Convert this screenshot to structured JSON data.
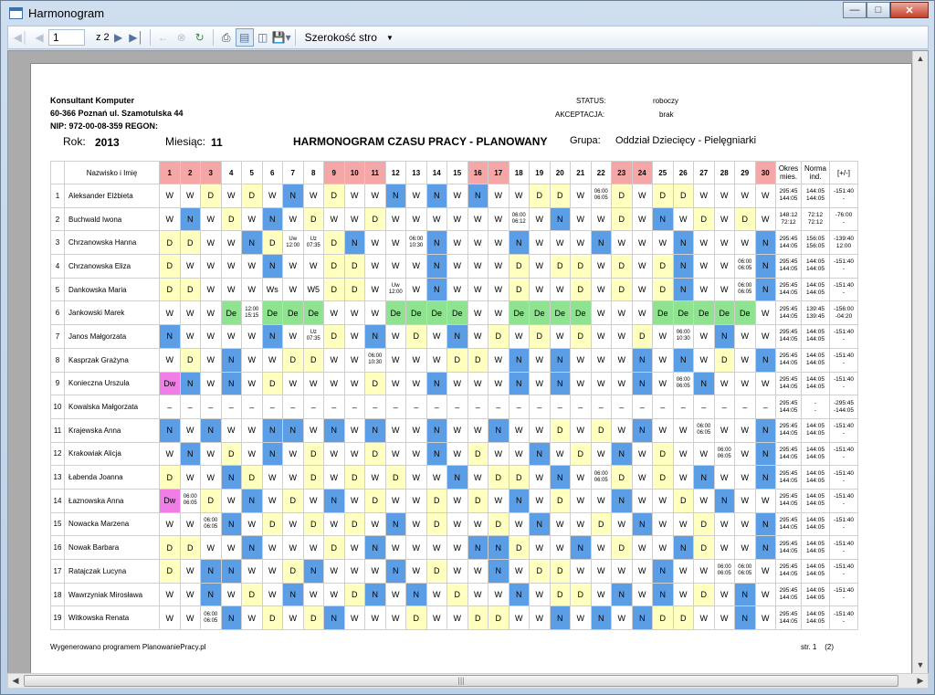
{
  "window": {
    "title": "Harmonogram"
  },
  "toolbar": {
    "page": "1",
    "of_label": "z",
    "total_pages": "2",
    "width_mode": "Szerokość stro"
  },
  "company": {
    "name": "Konsultant Komputer",
    "address": "60-366 Poznań ul. Szamotulska 44",
    "ids": "NIP: 972-00-08-359 REGON:"
  },
  "status": {
    "status_label": "STATUS:",
    "status_value": "roboczy",
    "accept_label": "AKCEPTACJA:",
    "accept_value": "brak"
  },
  "header": {
    "year_label": "Rok:",
    "year": "2013",
    "month_label": "Miesiąc:",
    "month": "11",
    "title": "HARMONOGRAM CZASU PRACY - PLANOWANY",
    "group_label": "Grupa:",
    "group": "Oddział Dziecięcy - Pielęgniarki"
  },
  "table": {
    "name_header": "Nazwisko i Imię",
    "days": [
      "1",
      "2",
      "3",
      "4",
      "5",
      "6",
      "7",
      "8",
      "9",
      "10",
      "11",
      "12",
      "13",
      "14",
      "15",
      "16",
      "17",
      "18",
      "19",
      "20",
      "21",
      "22",
      "23",
      "24",
      "25",
      "26",
      "27",
      "28",
      "29",
      "30"
    ],
    "red_days": [
      "1",
      "2",
      "3",
      "9",
      "10",
      "11",
      "16",
      "17",
      "23",
      "24",
      "30"
    ],
    "sum_headers": [
      "Okres mies.",
      "Norma ind.",
      "[+/-]"
    ],
    "rows": [
      {
        "lp": "1",
        "name": "Aleksander Elżbieta",
        "cells": [
          "W",
          "W",
          "D",
          "W",
          "D",
          "W",
          "N",
          "W",
          "D",
          "W",
          "W",
          "N",
          "W",
          "N",
          "W",
          "N",
          "W",
          "W",
          "D",
          "D",
          "W",
          "06:00 06:05",
          "D",
          "W",
          "D",
          "D",
          "W",
          "W",
          "W",
          "W"
        ],
        "okres": "295:45 144:05",
        "norma": "144:05 144:05",
        "diff": "-151:40 -"
      },
      {
        "lp": "2",
        "name": "Buchwald Iwona",
        "cells": [
          "W",
          "N",
          "W",
          "D",
          "W",
          "N",
          "W",
          "D",
          "W",
          "W",
          "D",
          "W",
          "W",
          "W",
          "W",
          "W",
          "W",
          "06:00 06:12",
          "W",
          "N",
          "W",
          "W",
          "D",
          "W",
          "N",
          "W",
          "D",
          "W",
          "D",
          "W"
        ],
        "okres": "148:12 72:12",
        "norma": "72:12 72:12",
        "diff": "-76:00 -"
      },
      {
        "lp": "3",
        "name": "Chrzanowska Hanna",
        "cells": [
          "D",
          "D",
          "W",
          "W",
          "N",
          "D",
          "Uw 12:00",
          "Uz 07:35",
          "D",
          "N",
          "W",
          "W",
          "06:00 10:30",
          "N",
          "W",
          "W",
          "W",
          "N",
          "W",
          "W",
          "W",
          "N",
          "W",
          "W",
          "W",
          "N",
          "W",
          "W",
          "W",
          "N"
        ],
        "okres": "295:45 144:05",
        "norma": "156:05 156:05",
        "diff": "-139:40 12:00"
      },
      {
        "lp": "4",
        "name": "Chrzanowska Eliza",
        "cells": [
          "D",
          "W",
          "W",
          "W",
          "W",
          "N",
          "W",
          "W",
          "D",
          "D",
          "W",
          "W",
          "W",
          "N",
          "W",
          "W",
          "W",
          "D",
          "W",
          "D",
          "D",
          "W",
          "D",
          "W",
          "D",
          "N",
          "W",
          "W",
          "06:00 06:05",
          "N"
        ],
        "okres": "295:45 144:05",
        "norma": "144:05 144:05",
        "diff": "-151:40 -"
      },
      {
        "lp": "5",
        "name": "Dankowska Maria",
        "cells": [
          "D",
          "D",
          "W",
          "W",
          "W",
          "Ws",
          "W",
          "W5",
          "D",
          "D",
          "W",
          "Uw 12:00",
          "W",
          "N",
          "W",
          "W",
          "W",
          "D",
          "W",
          "W",
          "D",
          "W",
          "D",
          "W",
          "D",
          "N",
          "W",
          "W",
          "06:00 06:05",
          "N"
        ],
        "okres": "295:45 144:05",
        "norma": "144:05 144:05",
        "diff": "-151:40 -"
      },
      {
        "lp": "6",
        "name": "Jankowski Marek",
        "cells": [
          "W",
          "W",
          "W",
          "De",
          "12:00 15:15",
          "De",
          "De",
          "De",
          "W",
          "W",
          "W",
          "De",
          "De",
          "De",
          "De",
          "W",
          "W",
          "De",
          "De",
          "De",
          "De",
          "W",
          "W",
          "W",
          "De",
          "De",
          "De",
          "De",
          "De",
          "W"
        ],
        "okres": "295:45 144:05",
        "norma": "139:45 139:45",
        "diff": "-156:00 -04:20"
      },
      {
        "lp": "7",
        "name": "Janos Małgorzata",
        "cells": [
          "N",
          "W",
          "W",
          "W",
          "W",
          "N",
          "W",
          "Uz 07:35",
          "D",
          "W",
          "N",
          "W",
          "D",
          "W",
          "N",
          "W",
          "D",
          "W",
          "D",
          "W",
          "D",
          "W",
          "W",
          "D",
          "W",
          "06:00 10:30",
          "W",
          "N",
          "W",
          "W"
        ],
        "okres": "295:45 144:05",
        "norma": "144:05 144:05",
        "diff": "-151:40 -"
      },
      {
        "lp": "8",
        "name": "Kasprzak Grażyna",
        "cells": [
          "W",
          "D",
          "W",
          "N",
          "W",
          "W",
          "D",
          "D",
          "W",
          "W",
          "06:00 10:30",
          "W",
          "W",
          "W",
          "D",
          "D",
          "W",
          "N",
          "W",
          "N",
          "W",
          "W",
          "W",
          "N",
          "W",
          "N",
          "W",
          "D",
          "W",
          "N"
        ],
        "okres": "295:45 144:05",
        "norma": "144:05 144:05",
        "diff": "-151:40 -"
      },
      {
        "lp": "9",
        "name": "Konieczna Urszula",
        "cells": [
          "Dw",
          "N",
          "W",
          "N",
          "W",
          "D",
          "W",
          "W",
          "W",
          "W",
          "D",
          "W",
          "W",
          "N",
          "W",
          "W",
          "W",
          "N",
          "W",
          "N",
          "W",
          "W",
          "W",
          "N",
          "W",
          "06:00 06:05",
          "N",
          "W",
          "W",
          "W"
        ],
        "okres": "295:45 144:05",
        "norma": "144:05 144:05",
        "diff": "-151:40 -"
      },
      {
        "lp": "10",
        "name": "Kowalska Małgorzata",
        "cells": [
          "–",
          "–",
          "–",
          "–",
          "–",
          "–",
          "–",
          "–",
          "–",
          "–",
          "–",
          "–",
          "–",
          "–",
          "–",
          "–",
          "–",
          "–",
          "–",
          "–",
          "–",
          "–",
          "–",
          "–",
          "–",
          "–",
          "–",
          "–",
          "–",
          "–"
        ],
        "okres": "295:45 144:05",
        "norma": "- -",
        "diff": "-295:45 -144:05"
      },
      {
        "lp": "11",
        "name": "Krajewska Anna",
        "cells": [
          "N",
          "W",
          "N",
          "W",
          "W",
          "N",
          "N",
          "W",
          "N",
          "W",
          "N",
          "W",
          "W",
          "N",
          "W",
          "W",
          "N",
          "W",
          "W",
          "D",
          "W",
          "D",
          "W",
          "N",
          "W",
          "W",
          "06:00 06:05",
          "W",
          "W",
          "N"
        ],
        "okres": "295:45 144:05",
        "norma": "144:05 144:05",
        "diff": "-151:40 -"
      },
      {
        "lp": "12",
        "name": "Krakowiak Alicja",
        "cells": [
          "W",
          "N",
          "W",
          "D",
          "W",
          "N",
          "W",
          "D",
          "W",
          "W",
          "D",
          "W",
          "W",
          "N",
          "W",
          "D",
          "W",
          "W",
          "N",
          "W",
          "D",
          "W",
          "N",
          "W",
          "D",
          "W",
          "W",
          "06:00 06:05",
          "W",
          "N"
        ],
        "okres": "295:45 144:05",
        "norma": "144:05 144:05",
        "diff": "-151:40 -"
      },
      {
        "lp": "13",
        "name": "Łabenda Joanna",
        "cells": [
          "D",
          "W",
          "W",
          "N",
          "D",
          "W",
          "W",
          "D",
          "W",
          "D",
          "W",
          "D",
          "W",
          "W",
          "N",
          "W",
          "D",
          "D",
          "W",
          "N",
          "W",
          "06:00 06:05",
          "D",
          "W",
          "D",
          "W",
          "N",
          "W",
          "W",
          "N"
        ],
        "okres": "295:45 144:05",
        "norma": "144:05 144:05",
        "diff": "-151:40 -"
      },
      {
        "lp": "14",
        "name": "Łaznowska Anna",
        "cells": [
          "Dw",
          "06:00 06:05",
          "D",
          "W",
          "N",
          "W",
          "D",
          "W",
          "N",
          "W",
          "D",
          "W",
          "W",
          "D",
          "W",
          "D",
          "W",
          "N",
          "W",
          "D",
          "W",
          "W",
          "N",
          "W",
          "W",
          "D",
          "W",
          "N",
          "W",
          "W"
        ],
        "okres": "295:45 144:05",
        "norma": "144:05 144:05",
        "diff": "-151:40 -"
      },
      {
        "lp": "15",
        "name": "Nowacka Marzena",
        "cells": [
          "W",
          "W",
          "06:00 06:05",
          "N",
          "W",
          "D",
          "W",
          "D",
          "W",
          "D",
          "W",
          "N",
          "W",
          "D",
          "W",
          "W",
          "D",
          "W",
          "N",
          "W",
          "W",
          "D",
          "W",
          "N",
          "W",
          "W",
          "D",
          "W",
          "W",
          "N"
        ],
        "okres": "295:45 144:05",
        "norma": "144:05 144:05",
        "diff": "-151:40 -"
      },
      {
        "lp": "16",
        "name": "Nowak Barbara",
        "cells": [
          "D",
          "D",
          "W",
          "W",
          "N",
          "W",
          "W",
          "W",
          "D",
          "W",
          "N",
          "W",
          "W",
          "W",
          "W",
          "N",
          "N",
          "D",
          "W",
          "W",
          "N",
          "W",
          "D",
          "W",
          "W",
          "N",
          "D",
          "W",
          "W",
          "N"
        ],
        "okres": "295:45 144:05",
        "norma": "144:05 144:05",
        "diff": "-151:40 -"
      },
      {
        "lp": "17",
        "name": "Ratajczak Lucyna",
        "cells": [
          "D",
          "W",
          "N",
          "N",
          "W",
          "W",
          "D",
          "N",
          "W",
          "W",
          "W",
          "N",
          "W",
          "D",
          "W",
          "W",
          "N",
          "W",
          "D",
          "D",
          "W",
          "W",
          "W",
          "W",
          "N",
          "W",
          "W",
          "06:00 06:05",
          "06:00 06:05",
          "W"
        ],
        "okres": "295:45 144:05",
        "norma": "144:05 144:05",
        "diff": "-151:40 -"
      },
      {
        "lp": "18",
        "name": "Wawrzyniak Mirosława",
        "cells": [
          "W",
          "W",
          "N",
          "W",
          "D",
          "W",
          "N",
          "W",
          "W",
          "D",
          "N",
          "W",
          "N",
          "W",
          "D",
          "W",
          "W",
          "N",
          "W",
          "D",
          "D",
          "W",
          "N",
          "W",
          "N",
          "W",
          "D",
          "W",
          "N",
          "W"
        ],
        "okres": "295:45 144:05",
        "norma": "144:05 144:05",
        "diff": "-151:40 -"
      },
      {
        "lp": "19",
        "name": "Witkowska Renata",
        "cells": [
          "W",
          "W",
          "06:00 06:05",
          "N",
          "W",
          "D",
          "W",
          "D",
          "N",
          "W",
          "W",
          "W",
          "D",
          "W",
          "W",
          "D",
          "D",
          "W",
          "W",
          "N",
          "W",
          "N",
          "W",
          "N",
          "D",
          "D",
          "W",
          "W",
          "N",
          "W"
        ],
        "okres": "295:45 144:05",
        "norma": "144:05 144:05",
        "diff": "-151:40 -"
      }
    ]
  },
  "footer": {
    "generated": "Wygenerowano programem PlanowaniePracy.pl",
    "page_label": "str. 1",
    "page_total": "(2)"
  }
}
